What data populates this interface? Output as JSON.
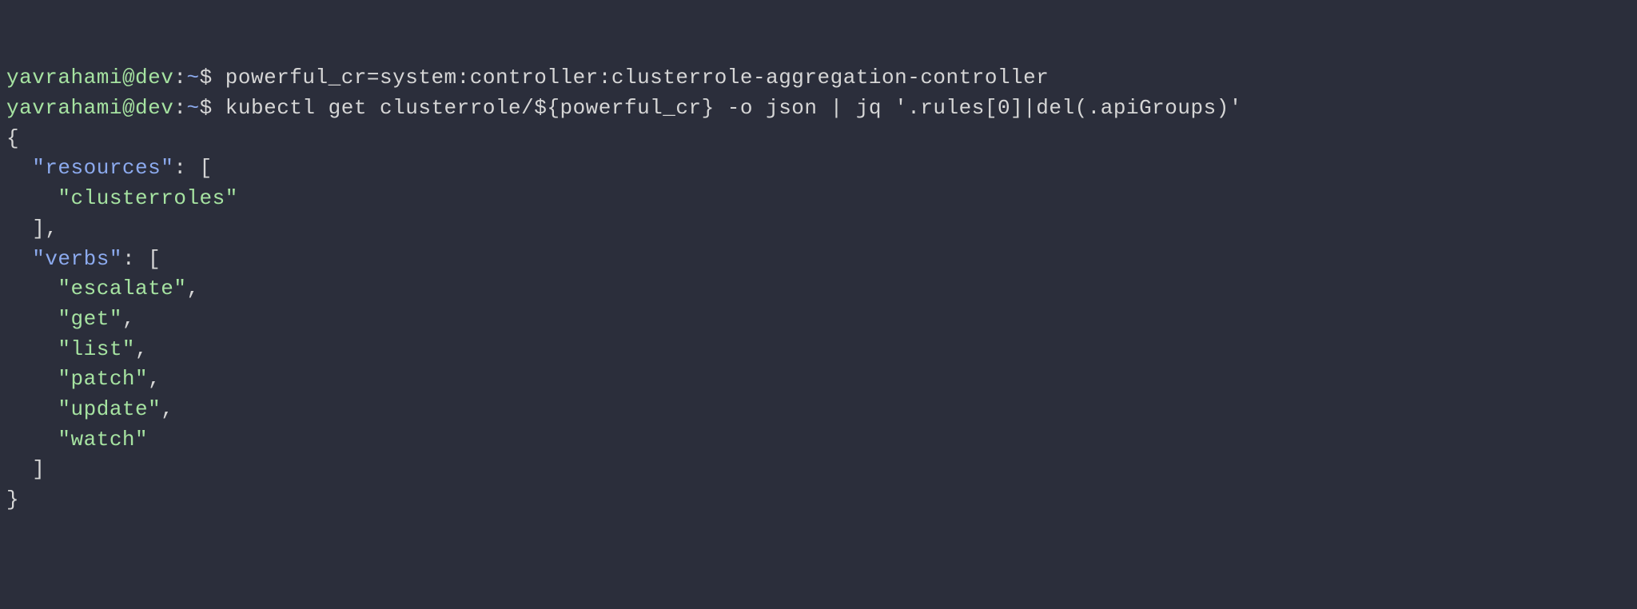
{
  "prompt": {
    "user": "yavrahami",
    "host": "dev",
    "path": "~",
    "symbol": "$"
  },
  "commands": {
    "line1": "powerful_cr=system:controller:clusterrole-aggregation-controller",
    "line2": "kubectl get clusterrole/${powerful_cr} -o json | jq '.rules[0]|del(.apiGroups)'"
  },
  "output": {
    "open_brace": "{",
    "resources_key": "\"resources\"",
    "resources_open": ": [",
    "resources_val0": "\"clusterroles\"",
    "resources_close": "],",
    "verbs_key": "\"verbs\"",
    "verbs_open": ": [",
    "verbs_val0": "\"escalate\"",
    "verbs_val1": "\"get\"",
    "verbs_val2": "\"list\"",
    "verbs_val3": "\"patch\"",
    "verbs_val4": "\"update\"",
    "verbs_val5": "\"watch\"",
    "verbs_close": "]",
    "close_brace": "}",
    "comma": ","
  }
}
